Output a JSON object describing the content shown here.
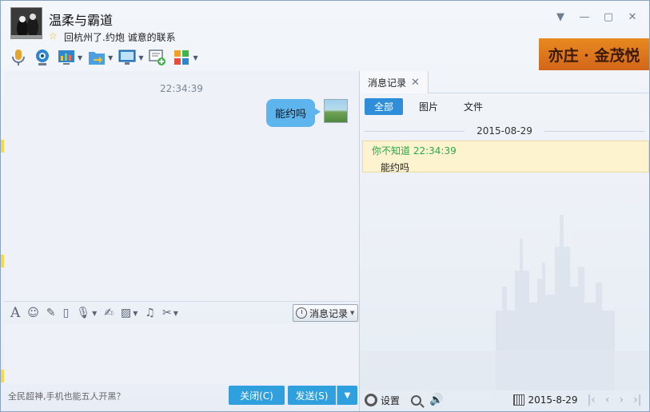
{
  "header": {
    "contact_name": "温柔与霸道",
    "signature": "回杭州了.约炮 诚意的联系",
    "ad_text": "亦庄 · 金茂悦",
    "toolbar": [
      {
        "name": "voice-call",
        "icon": "microphone-icon"
      },
      {
        "name": "video-call",
        "icon": "webcam-icon"
      },
      {
        "name": "app-center",
        "icon": "app-chart-icon"
      },
      {
        "name": "send-file",
        "icon": "folder-transfer-icon"
      },
      {
        "name": "remote-desktop",
        "icon": "monitor-icon"
      },
      {
        "name": "create-discussion",
        "icon": "chat-add-icon"
      },
      {
        "name": "more-apps",
        "icon": "grid-apps-icon"
      }
    ]
  },
  "chat": {
    "time": "22:34:39",
    "message": "能约吗"
  },
  "input": {
    "history_button": "消息记录",
    "ad_tip": "全民超神,手机也能五人开黑？",
    "close_button": "关闭(C)",
    "send_button": "发送(S)"
  },
  "history_panel": {
    "tab_label": "消息记录",
    "filters": [
      "全部",
      "图片",
      "文件"
    ],
    "date_separator": "2015-08-29",
    "entry_head": "你不知道 22:34:39",
    "entry_body": "能约吗",
    "settings_label": "设置",
    "date_picker": "2015-8-29"
  },
  "colors": {
    "accent": "#2f9fde",
    "bubble": "#5eb4ec",
    "history_highlight": "#fdf3cf",
    "sender_green": "#2ba84a"
  }
}
